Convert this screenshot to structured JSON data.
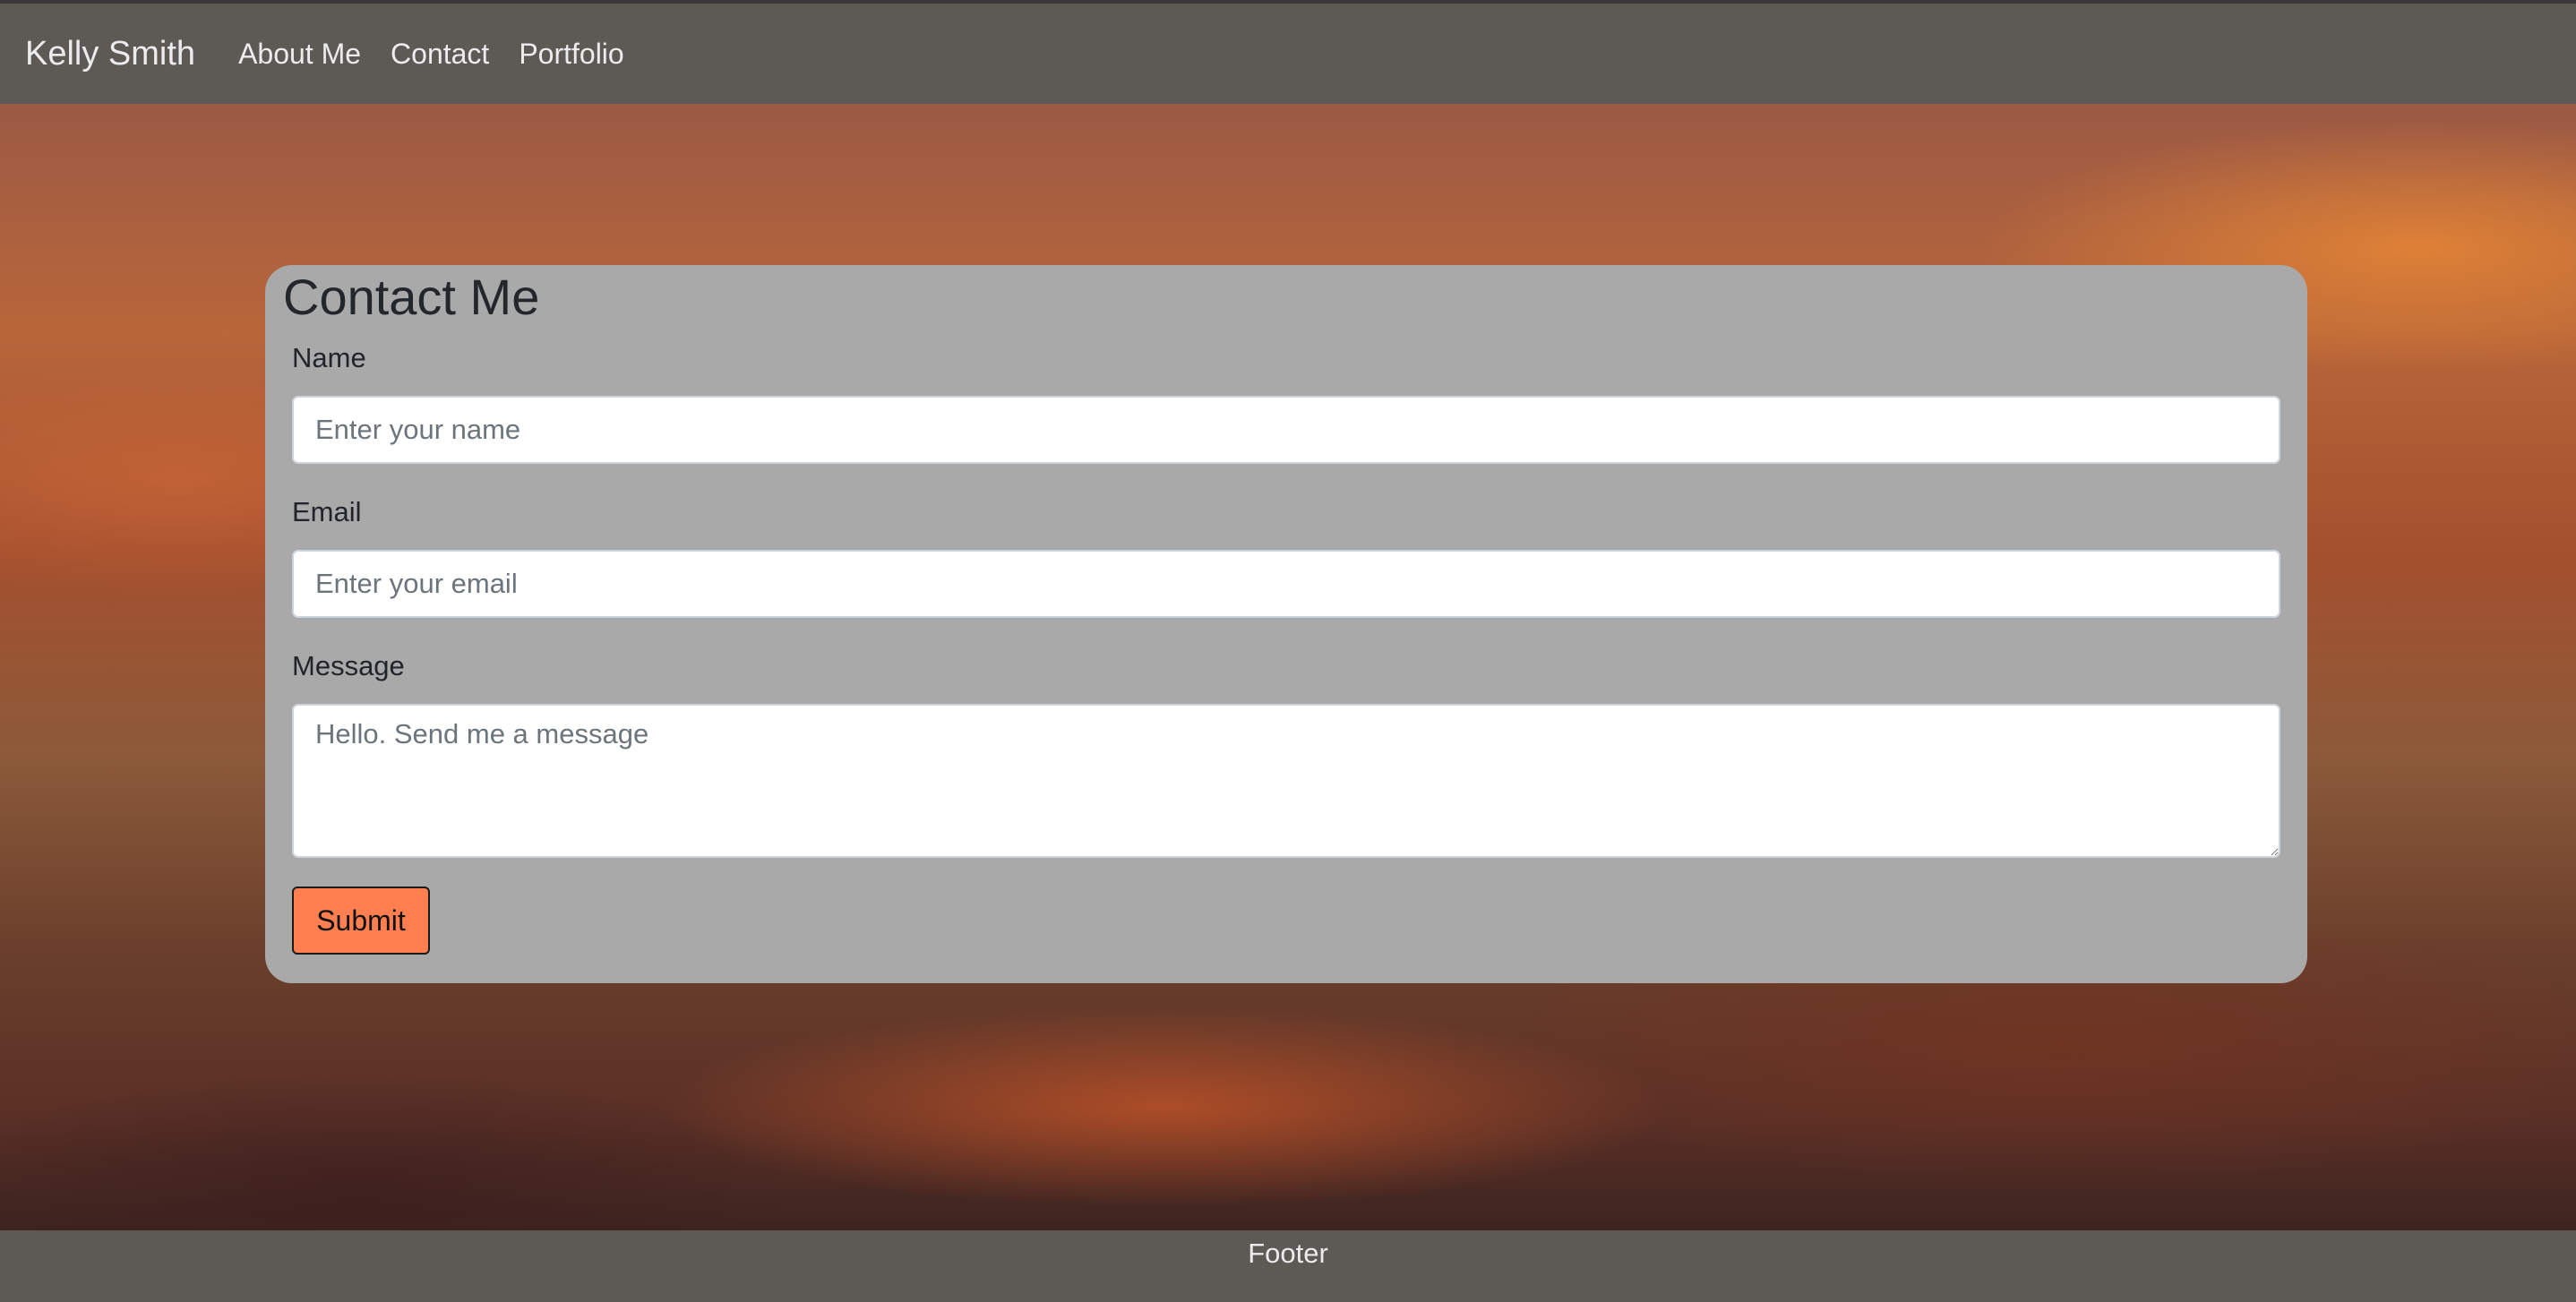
{
  "navbar": {
    "brand": "Kelly Smith",
    "links": [
      {
        "label": "About Me"
      },
      {
        "label": "Contact"
      },
      {
        "label": "Portfolio"
      }
    ]
  },
  "contact_form": {
    "title": "Contact Me",
    "name": {
      "label": "Name",
      "placeholder": "Enter your name",
      "value": ""
    },
    "email": {
      "label": "Email",
      "placeholder": "Enter your email",
      "value": ""
    },
    "message": {
      "label": "Message",
      "placeholder": "Hello. Send me a message",
      "value": ""
    },
    "submit_label": "Submit"
  },
  "footer": {
    "text": "Footer"
  },
  "colors": {
    "navbar_bg": "#5d5a56",
    "card_bg": "#a9a9a9",
    "submit_bg": "#ff7f50"
  }
}
